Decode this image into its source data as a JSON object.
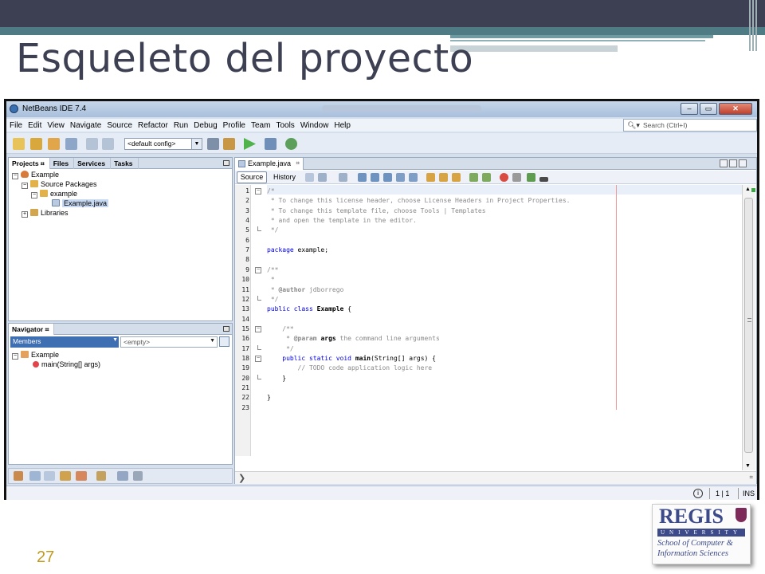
{
  "slide": {
    "title": "Esqueleto del proyecto",
    "page_number": "27",
    "logo": {
      "name": "REGIS",
      "sub": "UNIVERSITY",
      "school_line1": "School of Computer &",
      "school_line2": "Information Sciences"
    }
  },
  "ide": {
    "window_title": "NetBeans IDE 7.4",
    "menu": [
      "File",
      "Edit",
      "View",
      "Navigate",
      "Source",
      "Refactor",
      "Run",
      "Debug",
      "Profile",
      "Team",
      "Tools",
      "Window",
      "Help"
    ],
    "search_placeholder": "Search (Ctrl+I)",
    "config": "<default config>",
    "left_tabs": [
      "Projects",
      "Files",
      "Services",
      "Tasks"
    ],
    "project_tree": [
      {
        "label": "Example",
        "toggle": "−",
        "icon": "project"
      },
      {
        "label": "Source Packages",
        "toggle": "−",
        "icon": "package"
      },
      {
        "label": "example",
        "toggle": "−",
        "icon": "package"
      },
      {
        "label": "Example.java",
        "toggle": "",
        "icon": "java"
      },
      {
        "label": "Libraries",
        "toggle": "+",
        "icon": "library"
      }
    ],
    "navigator": {
      "title": "Navigator",
      "members": "Members",
      "empty": "<empty>",
      "tree": [
        {
          "label": "Example"
        },
        {
          "label": "main(String[] args)"
        }
      ]
    },
    "editor": {
      "file_tab": "Example.java",
      "source_tab": "Source",
      "history_tab": "History",
      "lines": [
        {
          "n": "1",
          "text": "/*"
        },
        {
          "n": "2",
          "text": " * To change this license header, choose License Headers in Project Properties."
        },
        {
          "n": "3",
          "text": " * To change this template file, choose Tools | Templates"
        },
        {
          "n": "4",
          "text": " * and open the template in the editor."
        },
        {
          "n": "5",
          "text": " */"
        },
        {
          "n": "6",
          "text": ""
        },
        {
          "n": "7",
          "text": "package example;"
        },
        {
          "n": "8",
          "text": ""
        },
        {
          "n": "9",
          "text": "/**"
        },
        {
          "n": "10",
          "text": " *"
        },
        {
          "n": "11",
          "text": " * @author jdborrego"
        },
        {
          "n": "12",
          "text": " */"
        },
        {
          "n": "13",
          "text": "public class Example {"
        },
        {
          "n": "14",
          "text": ""
        },
        {
          "n": "15",
          "text": "    /**"
        },
        {
          "n": "16",
          "text": "     * @param args the command line arguments"
        },
        {
          "n": "17",
          "text": "     */"
        },
        {
          "n": "18",
          "text": "    public static void main(String[] args) {"
        },
        {
          "n": "19",
          "text": "        // TODO code application logic here"
        },
        {
          "n": "20",
          "text": "    }"
        },
        {
          "n": "21",
          "text": ""
        },
        {
          "n": "22",
          "text": "}"
        },
        {
          "n": "23",
          "text": ""
        }
      ]
    },
    "status": {
      "position": "1 | 1",
      "mode": "INS"
    }
  }
}
